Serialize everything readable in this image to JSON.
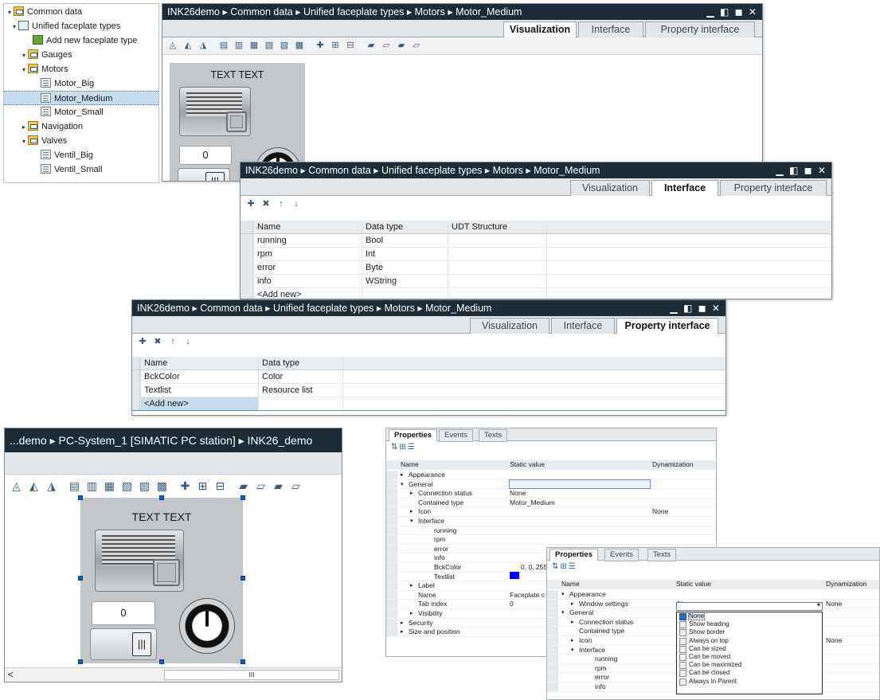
{
  "tree": {
    "items": [
      {
        "label": "Common data",
        "toggle": "▾",
        "icon": "common-data-folder-icon"
      },
      {
        "label": "Unified faceplate types",
        "toggle": "▾",
        "icon": "faceplate-library-icon"
      },
      {
        "label": "Add new faceplate type",
        "toggle": "",
        "icon": "add-faceplate-icon"
      },
      {
        "label": "Gauges",
        "toggle": "▾",
        "icon": "folder-icon"
      },
      {
        "label": "Motors",
        "toggle": "▾",
        "icon": "folder-icon"
      },
      {
        "label": "Motor_Big",
        "toggle": "",
        "icon": "faceplate-icon"
      },
      {
        "label": "Motor_Medium",
        "toggle": "",
        "icon": "faceplate-icon"
      },
      {
        "label": "Motor_Small",
        "toggle": "",
        "icon": "faceplate-icon"
      },
      {
        "label": "Navigation",
        "toggle": "▸",
        "icon": "folder-icon"
      },
      {
        "label": "Valves",
        "toggle": "▾",
        "icon": "folder-icon"
      },
      {
        "label": "Ventil_Big",
        "toggle": "",
        "icon": "faceplate-icon"
      },
      {
        "label": "Ventil_Small",
        "toggle": "",
        "icon": "faceplate-icon"
      }
    ]
  },
  "editor": {
    "breadcrumb": "INK26demo ▸ Common data ▸ Unified faceplate types ▸ Motors ▸ Motor_Medium",
    "window_controls": "▁ ◧ ◼ ✕",
    "tabs": [
      "Visualization",
      "Interface",
      "Property interface"
    ]
  },
  "faceplate": {
    "text": "TEXT TEXT",
    "value": "0",
    "knob": "|||"
  },
  "interface": {
    "columns": [
      "Name",
      "Data type",
      "UDT Structure"
    ],
    "rows": [
      {
        "name": "running",
        "type": "Bool"
      },
      {
        "name": "rpm",
        "type": "Int"
      },
      {
        "name": "error",
        "type": "Byte"
      },
      {
        "name": "info",
        "type": "WString"
      },
      {
        "name": "<Add new>",
        "type": ""
      }
    ]
  },
  "property_interface": {
    "columns": [
      "Name",
      "Data type"
    ],
    "rows": [
      {
        "name": "BckColor",
        "type": "Color"
      },
      {
        "name": "Textlist",
        "type": "Resource list"
      },
      {
        "name": "<Add new>",
        "type": ""
      }
    ]
  },
  "screen": {
    "breadcrumb": "...demo ▸ PC-System_1 [SIMATIC PC station] ▸ INK26_demo",
    "scroll_left": "<",
    "scroll_grip": "III"
  },
  "props1": {
    "tabs": [
      "Properties",
      "Events",
      "Texts"
    ],
    "columns": [
      "Name",
      "Static value",
      "Dynamization"
    ],
    "rows": [
      {
        "name": "Appearance",
        "value": "",
        "dyn": "",
        "tog": "▸",
        "indent": 0
      },
      {
        "name": "General",
        "value": "",
        "dyn": "",
        "tog": "▾",
        "indent": 0
      },
      {
        "name": "Connection status",
        "value": "None",
        "dyn": "",
        "tog": "▸",
        "indent": 1
      },
      {
        "name": "Contained type",
        "value": "Motor_Medium",
        "dyn": "",
        "tog": "",
        "indent": 1
      },
      {
        "name": "Icon",
        "value": "",
        "dyn": "None",
        "tog": "▸",
        "indent": 1
      },
      {
        "name": "Interface",
        "value": "",
        "dyn": "",
        "tog": "▾",
        "indent": 1
      },
      {
        "name": "running",
        "value": "",
        "dyn": "",
        "tog": "",
        "indent": 2
      },
      {
        "name": "rpm",
        "value": "",
        "dyn": "",
        "tog": "",
        "indent": 2
      },
      {
        "name": "error",
        "value": "",
        "dyn": "",
        "tog": "",
        "indent": 2
      },
      {
        "name": "info",
        "value": "",
        "dyn": "",
        "tog": "",
        "indent": 2
      },
      {
        "name": "BckColor",
        "value": "0, 0, 255",
        "dyn": "",
        "tog": "",
        "indent": 2
      },
      {
        "name": "Textlist",
        "value": "",
        "dyn": "",
        "tog": "",
        "indent": 2
      },
      {
        "name": "Label",
        "value": "",
        "dyn": "",
        "tog": "▸",
        "indent": 1
      },
      {
        "name": "Name",
        "value": "Faceplate c",
        "dyn": "",
        "tog": "",
        "indent": 1
      },
      {
        "name": "Tab index",
        "value": "0",
        "dyn": "",
        "tog": "",
        "indent": 1
      },
      {
        "name": "Visibility",
        "value": "",
        "dyn": "",
        "tog": "▸",
        "indent": 1
      },
      {
        "name": "Security",
        "value": "",
        "dyn": "",
        "tog": "▸",
        "indent": 0
      },
      {
        "name": "Size and position",
        "value": "",
        "dyn": "",
        "tog": "▸",
        "indent": 0
      }
    ],
    "swatch_color": "#0000ff"
  },
  "props2": {
    "tabs": [
      "Properties",
      "Events",
      "Texts"
    ],
    "columns": [
      "Name",
      "Static value",
      "Dynamization"
    ],
    "rows": [
      {
        "name": "Appearance",
        "value": "",
        "dyn": "",
        "tog": "▾",
        "indent": 0
      },
      {
        "name": "Window settings",
        "value": "None",
        "dyn": "None",
        "tog": "▸",
        "indent": 1
      },
      {
        "name": "General",
        "value": "",
        "dyn": "",
        "tog": "▾",
        "indent": 0
      },
      {
        "name": "Connection status",
        "value": "",
        "dyn": "",
        "tog": "▸",
        "indent": 1
      },
      {
        "name": "Contained type",
        "value": "",
        "dyn": "",
        "tog": "",
        "indent": 1
      },
      {
        "name": "Icon",
        "value": "",
        "dyn": "None",
        "tog": "▸",
        "indent": 1
      },
      {
        "name": "Interface",
        "value": "",
        "dyn": "",
        "tog": "▾",
        "indent": 1
      },
      {
        "name": "running",
        "value": "",
        "dyn": "",
        "tog": "",
        "indent": 2
      },
      {
        "name": "rpm",
        "value": "",
        "dyn": "",
        "tog": "",
        "indent": 2
      },
      {
        "name": "error",
        "value": "",
        "dyn": "",
        "tog": "",
        "indent": 2
      },
      {
        "name": "info",
        "value": "",
        "dyn": "",
        "tog": "",
        "indent": 2
      }
    ],
    "dropdown": [
      "None",
      "Show heading",
      "Show border",
      "Always on top",
      "Can be sized",
      "Can be moved",
      "Can be maximized",
      "Can be closed",
      "Always In Parent"
    ]
  }
}
